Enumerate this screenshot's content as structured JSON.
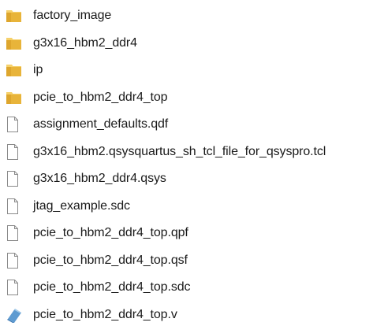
{
  "file_list": {
    "items": [
      {
        "name": "factory_image",
        "type": "folder",
        "icon": "folder-icon"
      },
      {
        "name": "g3x16_hbm2_ddr4",
        "type": "folder",
        "icon": "folder-icon"
      },
      {
        "name": "ip",
        "type": "folder",
        "icon": "folder-icon"
      },
      {
        "name": "pcie_to_hbm2_ddr4_top",
        "type": "folder",
        "icon": "folder-icon"
      },
      {
        "name": "assignment_defaults.qdf",
        "type": "file",
        "icon": "file-icon"
      },
      {
        "name": "g3x16_hbm2.qsysquartus_sh_tcl_file_for_qsyspro.tcl",
        "type": "file",
        "icon": "file-icon"
      },
      {
        "name": "g3x16_hbm2_ddr4.qsys",
        "type": "file",
        "icon": "file-icon"
      },
      {
        "name": "jtag_example.sdc",
        "type": "file",
        "icon": "file-icon"
      },
      {
        "name": "pcie_to_hbm2_ddr4_top.qpf",
        "type": "file",
        "icon": "file-icon"
      },
      {
        "name": "pcie_to_hbm2_ddr4_top.qsf",
        "type": "file",
        "icon": "file-icon"
      },
      {
        "name": "pcie_to_hbm2_ddr4_top.sdc",
        "type": "file",
        "icon": "file-icon"
      },
      {
        "name": "pcie_to_hbm2_ddr4_top.v",
        "type": "verilog",
        "icon": "verilog-file-icon"
      }
    ]
  },
  "colors": {
    "folder_body": "#e8b43a",
    "folder_back": "#f6d16b",
    "file_stroke": "#8a8a8a",
    "verilog_icon": "#5e9bd1",
    "text": "#1a1a1a"
  }
}
